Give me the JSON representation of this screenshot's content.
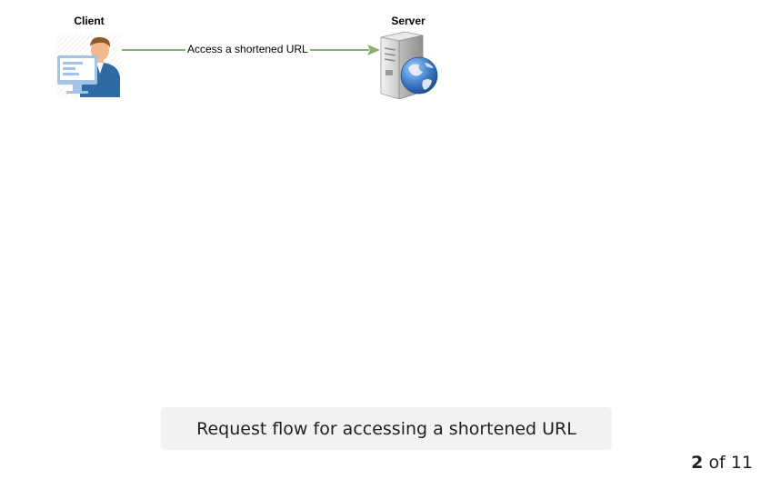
{
  "diagram": {
    "nodes": [
      {
        "id": "client",
        "label": "Client",
        "icon": "client-user-icon"
      },
      {
        "id": "server",
        "label": "Server",
        "icon": "web-server-icon"
      }
    ],
    "edges": [
      {
        "from": "client",
        "to": "server",
        "label": "Access a shortened URL"
      }
    ],
    "colors": {
      "edge": "#82b366",
      "monitor": "#a4c4e6",
      "person_shirt": "#2f6aa3",
      "person_skin": "#f1b98c",
      "person_hair": "#8a5a2b",
      "server_body": "#d9d9d9",
      "globe": "#3d7bc8"
    }
  },
  "caption": "Request flow for accessing a shortened URL",
  "pager": {
    "current": "2",
    "separator": "of",
    "total": "11"
  }
}
